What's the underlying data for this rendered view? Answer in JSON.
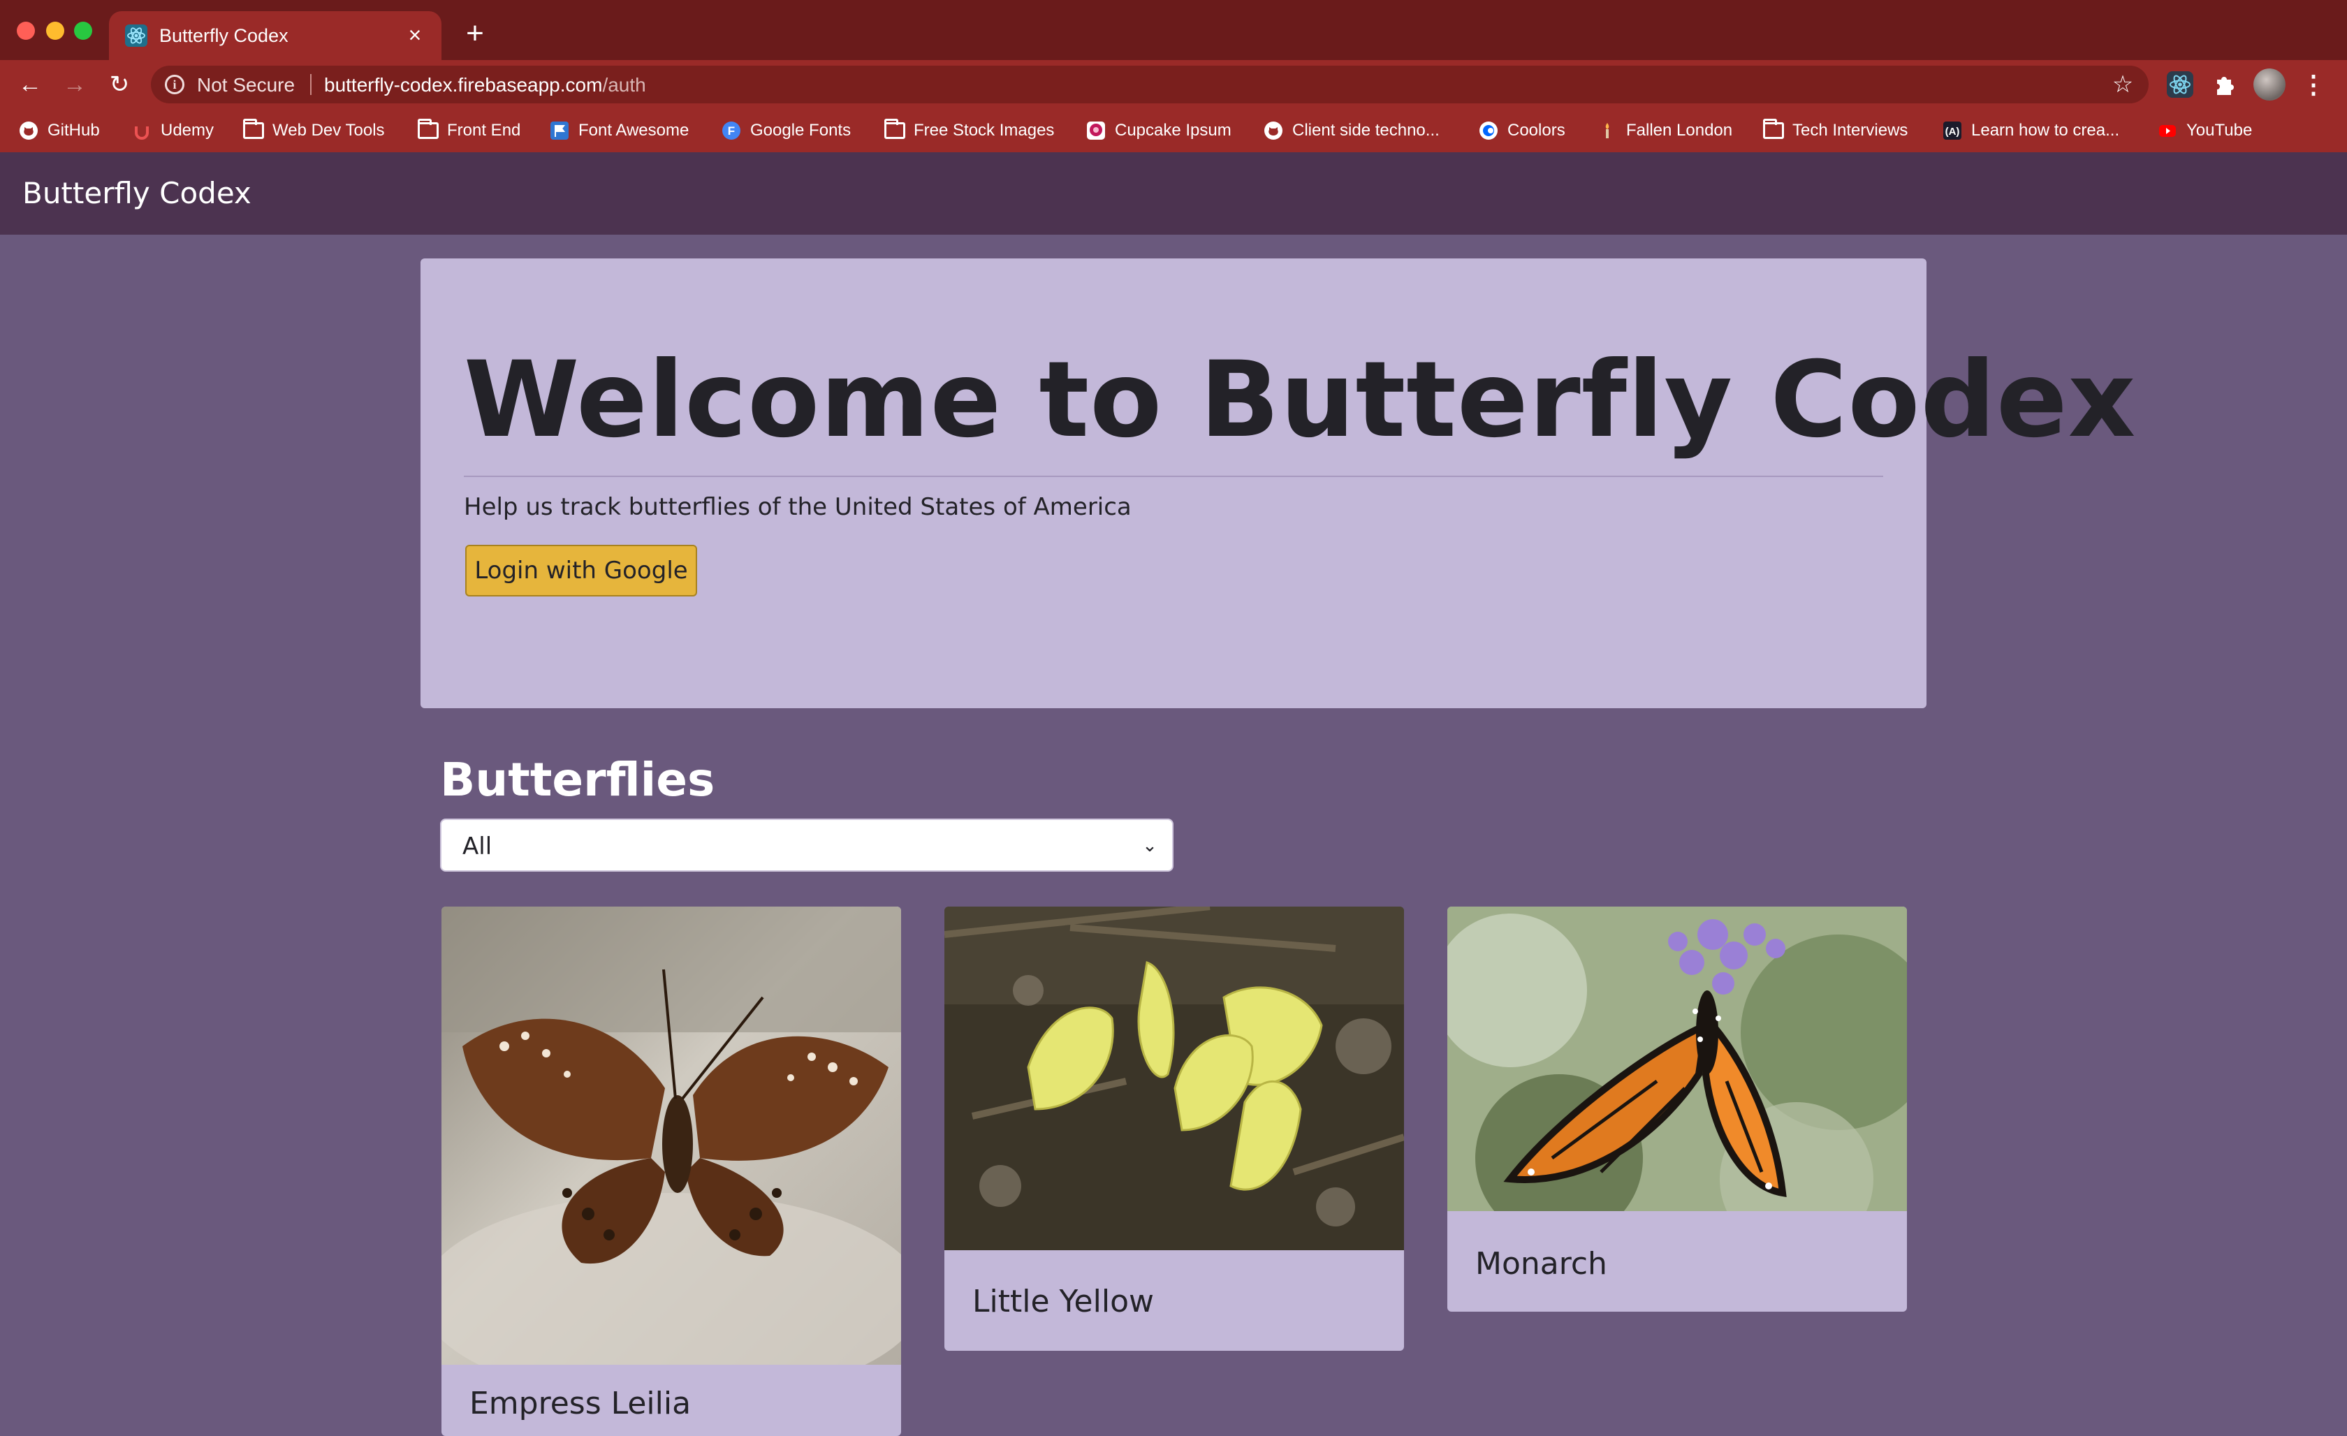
{
  "browser": {
    "tab": {
      "title": "Butterfly Codex",
      "close_glyph": "×"
    },
    "new_tab_glyph": "+",
    "nav": {
      "back_glyph": "←",
      "forward_glyph": "→",
      "reload_glyph": "↻"
    },
    "omnibox": {
      "security_label": "Not Secure",
      "url_host": "butterfly-codex.firebaseapp.com",
      "url_path": "/auth",
      "star_glyph": "☆"
    },
    "menu_glyph": "⋮",
    "bookmarks": [
      {
        "label": "GitHub",
        "icon": "github-icon"
      },
      {
        "label": "Udemy",
        "icon": "udemy-icon"
      },
      {
        "label": "Web Dev Tools",
        "icon": "folder-icon"
      },
      {
        "label": "Front End",
        "icon": "folder-icon"
      },
      {
        "label": "Font Awesome",
        "icon": "font-awesome-icon"
      },
      {
        "label": "Google Fonts",
        "icon": "google-fonts-icon"
      },
      {
        "label": "Free Stock Images",
        "icon": "folder-icon"
      },
      {
        "label": "Cupcake Ipsum",
        "icon": "cupcake-icon"
      },
      {
        "label": "Client side techno...",
        "icon": "github-icon"
      },
      {
        "label": "Coolors",
        "icon": "coolors-icon"
      },
      {
        "label": "Fallen London",
        "icon": "candle-icon"
      },
      {
        "label": "Tech Interviews",
        "icon": "folder-icon"
      },
      {
        "label": "Learn how to crea...",
        "icon": "angular-icon"
      },
      {
        "label": "YouTube",
        "icon": "youtube-icon"
      }
    ]
  },
  "app": {
    "brand": "Butterfly Codex",
    "jumbotron": {
      "title": "Welcome to Butterfly Codex",
      "subtitle": "Help us track butterflies of the United States of America",
      "login_label": "Login with Google"
    },
    "butterflies": {
      "heading": "Butterflies",
      "filter_selected": "All",
      "cards": [
        {
          "title": "Empress Leilia"
        },
        {
          "title": "Little Yellow"
        },
        {
          "title": "Monarch"
        }
      ]
    }
  },
  "colors": {
    "tabbar": "#6a1b1b",
    "toolbar": "#9a2a28",
    "app_nav": "#4c3350",
    "page_bg": "#6a597d",
    "jumbotron_bg": "#c3b8d9",
    "login_button": "#e6b53c"
  }
}
